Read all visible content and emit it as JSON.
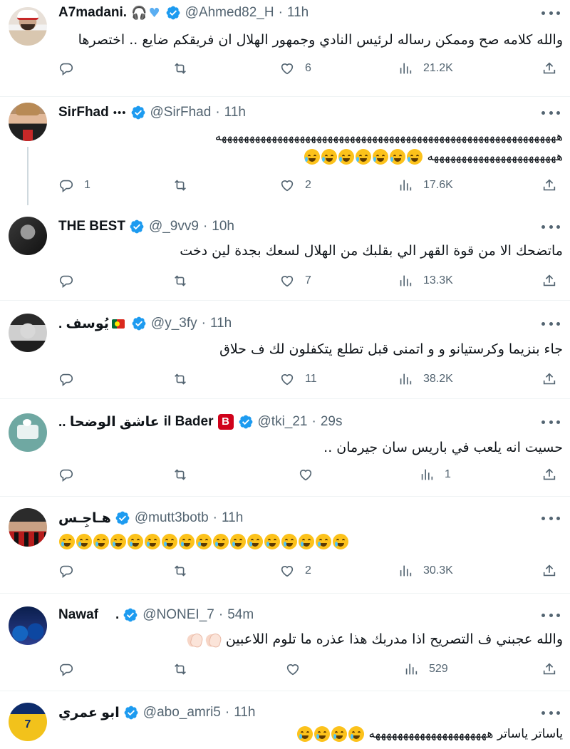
{
  "colors": {
    "verified": "#1d9bf0",
    "muted": "#536471",
    "divider": "#eff3f4",
    "text": "#0f1419"
  },
  "tweets": [
    {
      "name": "A7madani.",
      "handle": "@Ahmed82_H",
      "time": "11h",
      "text": "والله كلامه صح وممكن رساله لرئيس النادي وجمهور الهلال  ان فريقكم  ضايع .. اختصرها",
      "replies": "",
      "retweets": "",
      "likes": "6",
      "views": "21.2K"
    },
    {
      "name": "SirFhad",
      "name_suffix": "•••",
      "handle": "@SirFhad",
      "time": "11h",
      "text_line1": "هههههههههههههههههههههههههههههههههههههههههههههههههههههههههههههه",
      "text_line2": "هههههههههههههههههههههههه",
      "replies": "1",
      "retweets": "",
      "likes": "2",
      "views": "17.6K"
    },
    {
      "name": "THE BEST",
      "handle": "@_9vv9",
      "time": "10h",
      "text": "ماتضحك الا من قوة القهر الي بقلبك من الهلال لسعك بجدة لين دخت",
      "replies": "",
      "retweets": "",
      "likes": "7",
      "views": "13.3K"
    },
    {
      "name": "يُوسف .",
      "handle": "@y_3fy",
      "time": "11h",
      "text": "جاء بنزيما وكرستيانو و و اتمنى قبل تطلع يتكفلون لك ف حلاق",
      "replies": "",
      "retweets": "",
      "likes": "11",
      "views": "38.2K"
    },
    {
      "name": "il Bader",
      "name_prefix": "عاشق الوضحا ..",
      "handle": "@tki_21",
      "time": "29s",
      "text": "حسيت انه يلعب في باريس سان جيرمان ..",
      "replies": "",
      "retweets": "",
      "likes": "",
      "views": "1"
    },
    {
      "name": "هـاجِـس",
      "handle": "@mutt3botb",
      "time": "11h",
      "replies": "",
      "retweets": "",
      "likes": "2",
      "views": "30.3K"
    },
    {
      "name": "Nawaf",
      "name_suffix": ".",
      "handle": "@NONEI_7",
      "time": "54m",
      "text": "والله عجبني ف التصريح اذا مدربك هذا عذره ما تلوم اللاعبين",
      "replies": "",
      "retweets": "",
      "likes": "",
      "views": "529"
    },
    {
      "name": "ابو عمري",
      "handle": "@abo_amri5",
      "time": "11h",
      "text_start": "ياساتر ياساتر هههههههههههههههههههههه"
    }
  ],
  "icons": {
    "reply": "reply-icon",
    "retweet": "retweet-icon",
    "like": "heart-icon",
    "views": "views-chart-icon",
    "share": "share-icon",
    "verified": "verified-badge-icon",
    "more": "more-icon"
  }
}
